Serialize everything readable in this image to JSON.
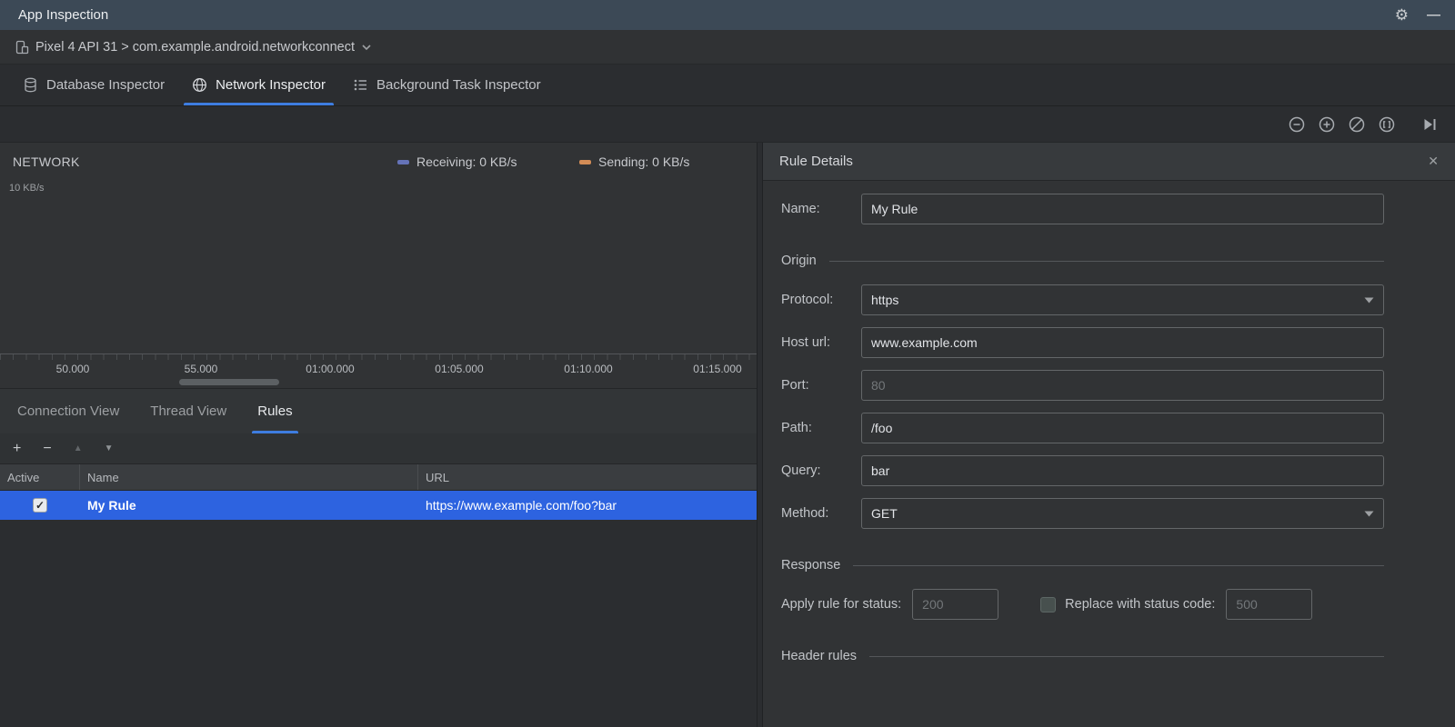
{
  "colors": {
    "selection": "#2D63E0",
    "tab_underline": "#3E7DE0",
    "receiving": "#6573B8",
    "sending": "#D38C56"
  },
  "icons": {
    "gear": "⚙",
    "minimize": "—",
    "close": "✕",
    "check": "✓",
    "add": "+",
    "remove": "−",
    "move_up": "▲",
    "move_down": "▼"
  },
  "titlebar": {
    "title": "App Inspection"
  },
  "process_bar": {
    "selector": "Pixel 4 API 31 > com.example.android.networkconnect"
  },
  "inspector_tabs": [
    {
      "label": "Database Inspector"
    },
    {
      "label": "Network Inspector"
    },
    {
      "label": "Background Task Inspector"
    }
  ],
  "network": {
    "title": "NETWORK",
    "y_label": "10 KB/s",
    "legend": [
      {
        "label": "Receiving: 0 KB/s",
        "color": "#6573B8"
      },
      {
        "label": "Sending: 0 KB/s",
        "color": "#D38C56"
      }
    ],
    "ticks": [
      "50.000",
      "55.000",
      "01:00.000",
      "01:05.000",
      "01:10.000",
      "01:15.000"
    ],
    "view_tabs": [
      {
        "label": "Connection View"
      },
      {
        "label": "Thread View"
      },
      {
        "label": "Rules"
      }
    ],
    "rules_table": {
      "columns": [
        "Active",
        "Name",
        "URL"
      ],
      "rows": [
        {
          "active": true,
          "name": "My Rule",
          "url": "https://www.example.com/foo?bar"
        }
      ]
    }
  },
  "rule_details": {
    "title": "Rule Details",
    "name_label": "Name:",
    "name_value": "My Rule",
    "sections": {
      "origin": "Origin",
      "response": "Response",
      "header_rules": "Header rules"
    },
    "fields": {
      "protocol": {
        "label": "Protocol:",
        "value": "https"
      },
      "host": {
        "label": "Host url:",
        "value": "www.example.com"
      },
      "port": {
        "label": "Port:",
        "placeholder": "80"
      },
      "path": {
        "label": "Path:",
        "value": "/foo"
      },
      "query": {
        "label": "Query:",
        "value": "bar"
      },
      "method": {
        "label": "Method:",
        "value": "GET"
      }
    },
    "response_row": {
      "apply_label": "Apply rule for status:",
      "apply_placeholder": "200",
      "replace_label": "Replace with status code:",
      "replace_placeholder": "500"
    }
  }
}
